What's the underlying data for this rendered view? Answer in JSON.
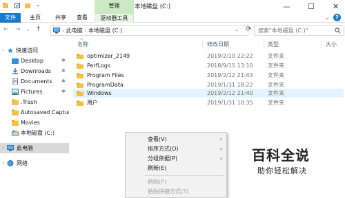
{
  "titlebar": {
    "manage_tab": "管理",
    "title": "本地磁盘 (C:)",
    "minimize": "—",
    "maximize": "☐",
    "close": "✕"
  },
  "ribbon": {
    "tabs": [
      "文件",
      "主页",
      "共享",
      "查看",
      "驱动器工具"
    ],
    "expand_chevron": "⌄",
    "help": "?"
  },
  "nav": {
    "back": "←",
    "forward": "→",
    "recent": "⌄",
    "up": "↑",
    "breadcrumb_sep": "›",
    "path": [
      "此电脑",
      "本地磁盘 (C:)"
    ],
    "refresh": "⟳",
    "dropdown": "⌄",
    "search_placeholder": "搜索\"本地磁盘 (C:)\""
  },
  "sidebar": {
    "items": [
      {
        "label": "快速访问",
        "icon": "star-icon",
        "pinned": false
      },
      {
        "label": "Desktop",
        "icon": "desktop-folder-icon",
        "pinned": true
      },
      {
        "label": "Downloads",
        "icon": "downloads-icon",
        "pinned": true
      },
      {
        "label": "Documents",
        "icon": "documents-icon",
        "pinned": true
      },
      {
        "label": "Pictures",
        "icon": "pictures-icon",
        "pinned": true
      },
      {
        "label": ".Trash",
        "icon": "folder-icon",
        "pinned": false
      },
      {
        "label": "Autosaved Capture",
        "icon": "folder-icon",
        "pinned": false
      },
      {
        "label": "Movies",
        "icon": "folder-icon",
        "pinned": false
      },
      {
        "label": "本地磁盘 (C:)",
        "icon": "drive-icon",
        "pinned": false
      },
      {
        "label": "此电脑",
        "icon": "computer-icon",
        "pinned": false
      },
      {
        "label": "网络",
        "icon": "network-icon",
        "pinned": false
      }
    ],
    "pin_glyph": "✱"
  },
  "table": {
    "headers": [
      "名称",
      "修改日期",
      "类型",
      "大小"
    ],
    "sort_indicator": "^",
    "rows": [
      {
        "name": "optimizer_2149",
        "date": "2019/2/10 22:22",
        "type": "文件夹"
      },
      {
        "name": "PerfLogs",
        "date": "2018/9/15 13:10",
        "type": "文件夹"
      },
      {
        "name": "Program Files",
        "date": "2019/2/12 21:43",
        "type": "文件夹"
      },
      {
        "name": "ProgramData",
        "date": "2019/1/31 18:22",
        "type": "文件夹"
      },
      {
        "name": "Windows",
        "date": "2019/2/12 21:40",
        "type": "文件夹"
      },
      {
        "name": "用户",
        "date": "2019/1/31 10:35",
        "type": "文件夹"
      }
    ]
  },
  "context_menu": {
    "items": [
      {
        "label": "查看(V)",
        "submenu": true,
        "disabled": false
      },
      {
        "label": "排序方式(O)",
        "submenu": true,
        "disabled": false
      },
      {
        "label": "分组依据(P)",
        "submenu": true,
        "disabled": false
      },
      {
        "label": "刷新(E)",
        "submenu": false,
        "disabled": false
      },
      {
        "label": "粘贴(P)",
        "submenu": false,
        "disabled": true
      },
      {
        "label": "粘贴快捷方式(S)",
        "submenu": false,
        "disabled": true
      }
    ],
    "arrow": "›"
  },
  "watermark": {
    "logo": "百科全说",
    "subtitle": "助你轻松解决"
  },
  "colors": {
    "accent": "#1979ca",
    "manage_tab": "#cbe9c3",
    "folder": "#f0c14b",
    "selection": "#d9d9d9",
    "hover_row": "#e5f3ff"
  }
}
